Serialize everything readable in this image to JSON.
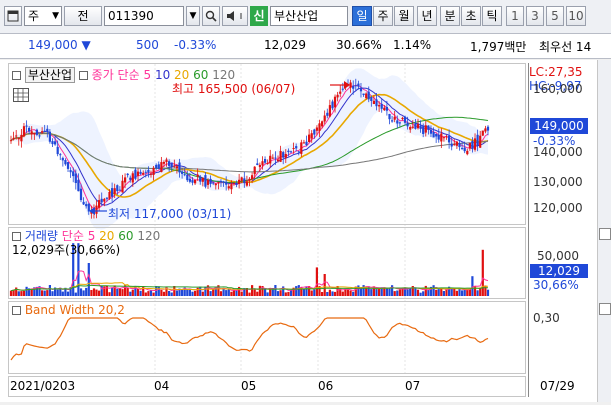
{
  "toolbar": {
    "code_type": "주",
    "mode_label": "전",
    "stock_code": "011390",
    "badge_label": "신",
    "stock_name": "부산산업",
    "periods": [
      "일",
      "주",
      "월",
      "년",
      "분",
      "초",
      "틱"
    ],
    "active_period": "일",
    "numbers": [
      "1",
      "3",
      "5",
      "10"
    ]
  },
  "quote": {
    "price": "149,000",
    "change_arrow": "▼",
    "change": "500",
    "change_pct": "-0.33%",
    "volume": "12,029",
    "ratio1": "30.66%",
    "ratio2": "1.14%",
    "amount": "1,797백만",
    "extra": "최우선 14"
  },
  "price_panel": {
    "name_label": "부산산업",
    "ma_label": "종가 단순",
    "ma_periods": [
      "5",
      "10",
      "20",
      "60",
      "120"
    ],
    "ma_colors": [
      "#ff3399",
      "#3333cc",
      "#e8a800",
      "#2a9a2a",
      "#777777"
    ],
    "lc": "LC:27,35",
    "hc": "HC:-9,97",
    "high_annot": "최고 165,500 (06/07)",
    "low_annot": "최저 117,000 (03/11)",
    "current_price": "149,000",
    "current_pct": "-0.33%",
    "y_ticks": [
      "160,000",
      "140,000",
      "130,000",
      "120,000"
    ]
  },
  "volume_panel": {
    "title": "거래량",
    "ma_label": "단순",
    "ma_periods": [
      "5",
      "20",
      "60",
      "120"
    ],
    "current_label": "12,029주(30,66%)",
    "axis_top": "50,000",
    "axis_current": "12,029",
    "axis_pct": "30,66%"
  },
  "band_panel": {
    "title": "Band Width 20,2",
    "axis_label": "0,30"
  },
  "x_axis": {
    "labels": [
      "2021/02",
      "03",
      "04",
      "05",
      "06",
      "07"
    ],
    "end_label": "07/29"
  },
  "chart_data": {
    "type": "candlestick",
    "series": [
      {
        "name": "부산산업",
        "high": 165500,
        "low": 117000,
        "last": 149000
      }
    ]
  }
}
